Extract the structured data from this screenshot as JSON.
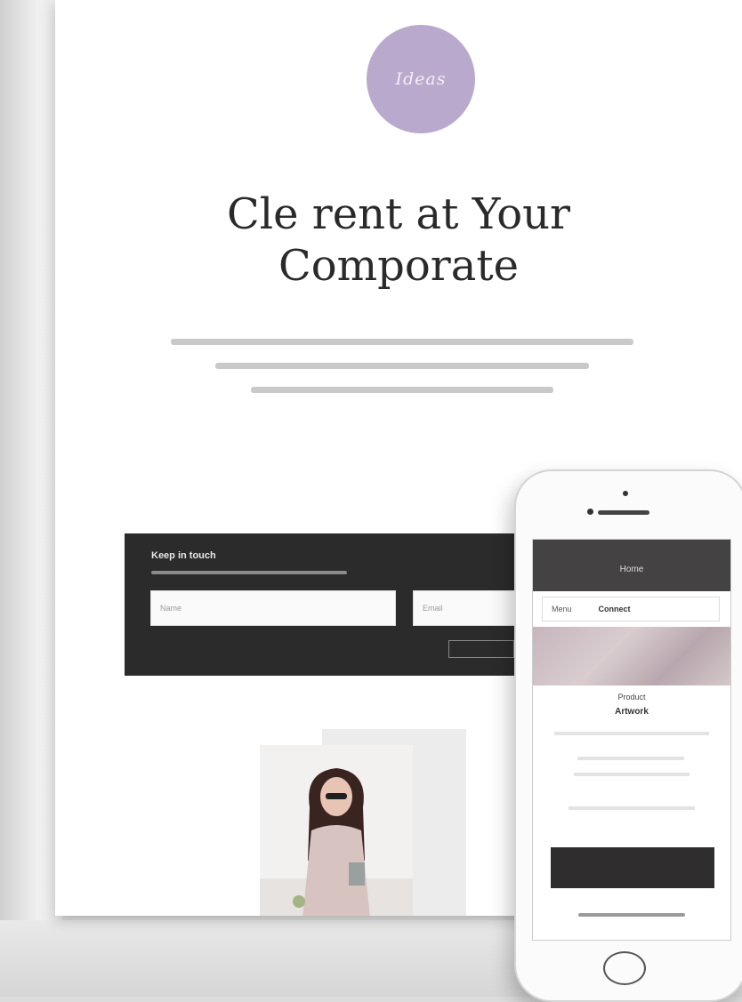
{
  "brand": {
    "logo_text": "Ideas"
  },
  "hero": {
    "title_line1": "Cle rent at Your",
    "title_line2": "Comporate"
  },
  "signup_panel": {
    "title": "Keep in touch",
    "first_placeholder": "Name",
    "second_placeholder": "Email"
  },
  "phone": {
    "header": "Home",
    "select_label": "Menu",
    "select_value": "Connect",
    "product_name": "Product",
    "product_subtitle": "Artwork"
  },
  "colors": {
    "logo_circle": "#b9a9cc",
    "dark_panel": "#2c2b2c",
    "page_bg": "#ffffff"
  }
}
